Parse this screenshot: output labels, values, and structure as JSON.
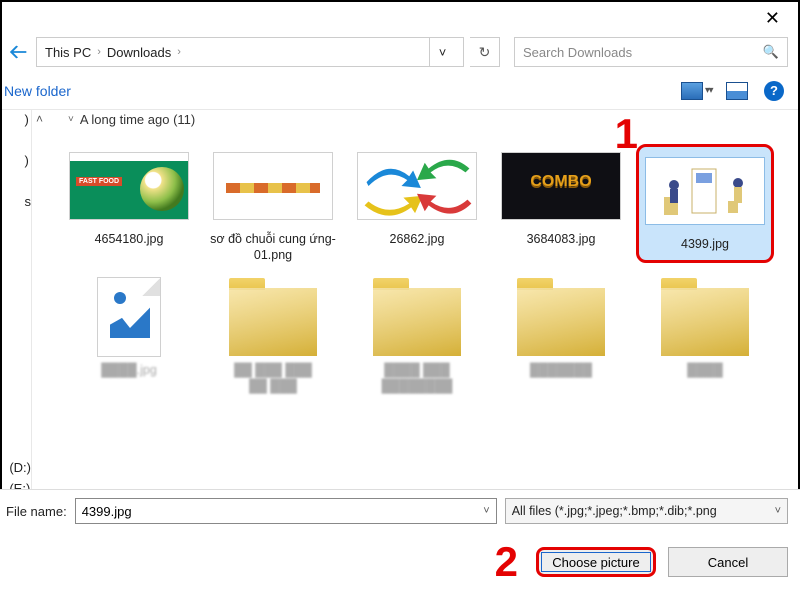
{
  "window": {
    "close_tooltip": "Close"
  },
  "breadcrumb": {
    "root": "This PC",
    "folder": "Downloads"
  },
  "search": {
    "placeholder": "Search Downloads"
  },
  "toolbar": {
    "new_folder": "New folder"
  },
  "sidebar": {
    "paren1": ")",
    "paren2": ")",
    "s_item": "s",
    "drive_d": "(D:)",
    "drive_e": "(E:)"
  },
  "group": {
    "label": "A long time ago (11)"
  },
  "files": {
    "grid": [
      {
        "name": "4654180.jpg"
      },
      {
        "name": "sơ đồ chuỗi cung ứng-01.png"
      },
      {
        "name": "26862.jpg"
      },
      {
        "name": "3684083.jpg"
      },
      {
        "name": "4399.jpg"
      }
    ]
  },
  "bottom": {
    "file_name_label": "File name:",
    "file_name_value": "4399.jpg",
    "filter": "All files (*.jpg;*.jpeg;*.bmp;*.dib;*.png",
    "choose": "Choose picture",
    "cancel": "Cancel"
  },
  "annotations": {
    "one": "1",
    "two": "2"
  }
}
